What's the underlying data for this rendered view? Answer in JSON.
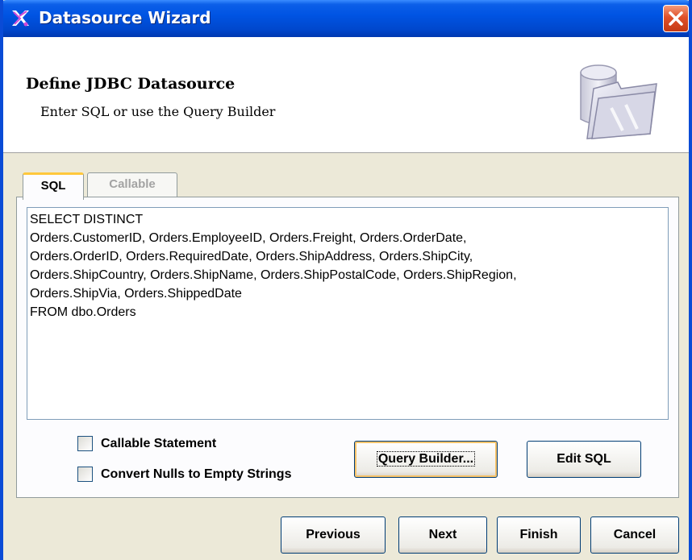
{
  "window": {
    "title": "Datasource Wizard",
    "icon": "wizard-icon"
  },
  "header": {
    "title": "Define JDBC Datasource",
    "subtitle": "Enter SQL or use the Query Builder",
    "graphic": "datasource-folder-icon"
  },
  "tabs": [
    {
      "label": "SQL",
      "selected": true
    },
    {
      "label": "Callable",
      "selected": false
    }
  ],
  "sql": {
    "lines": [
      "SELECT DISTINCT",
      "Orders.CustomerID, Orders.EmployeeID, Orders.Freight, Orders.OrderDate,",
      "Orders.OrderID, Orders.RequiredDate, Orders.ShipAddress, Orders.ShipCity,",
      "Orders.ShipCountry, Orders.ShipName, Orders.ShipPostalCode, Orders.ShipRegion,",
      "Orders.ShipVia, Orders.ShippedDate",
      "FROM dbo.Orders"
    ]
  },
  "options": {
    "callable_statement": {
      "label": "Callable Statement",
      "checked": false
    },
    "convert_nulls": {
      "label": "Convert Nulls to Empty Strings",
      "checked": false
    }
  },
  "buttons": {
    "query_builder": "Query Builder...",
    "edit_sql": "Edit SQL",
    "previous": "Previous",
    "next": "Next",
    "finish": "Finish",
    "cancel": "Cancel"
  },
  "colors": {
    "titlebar": "#0054e3",
    "window_bg": "#ece9d8",
    "tab_highlight": "#ffc83c",
    "disabled_text": "#a3a3a3"
  }
}
